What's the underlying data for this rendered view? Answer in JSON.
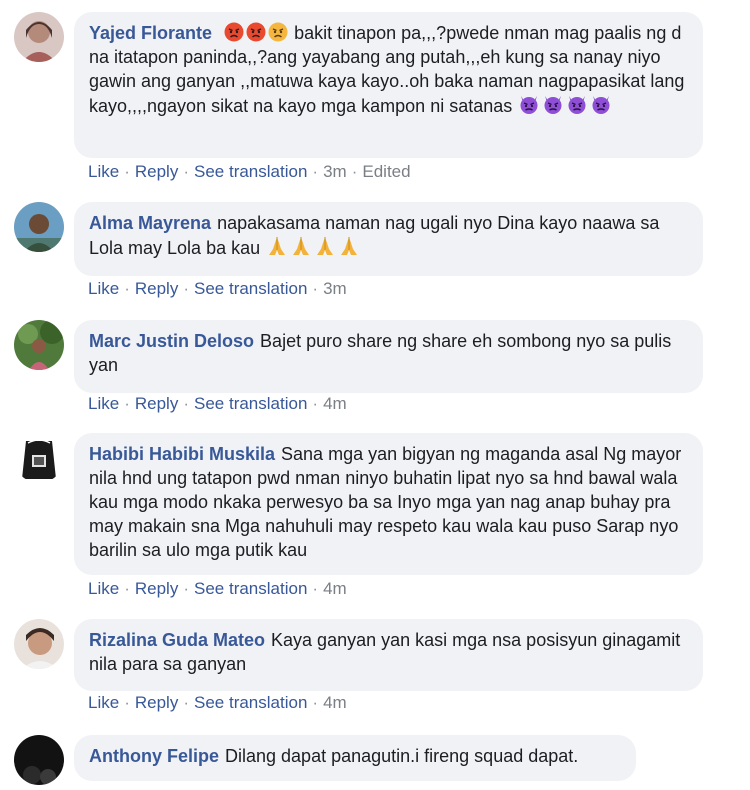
{
  "comments": [
    {
      "author": "Yajed Florante",
      "text": "bakit tinapon pa,,,?pwede nman mag paalis ng d na itatapon paninda,,?ang yayabang ang putah,,,eh kung sa nanay niyo gawin ang ganyan ,,matuwa kaya kayo..oh baka naman nagpapasikat lang kayo,,,,ngayon sikat na kayo mga kampon ni satanas",
      "leading_emoji": [
        "angry-face-icon",
        "angry-face-icon",
        "frowning-face-icon"
      ],
      "trailing_emoji": [
        "devil-face-icon",
        "devil-face-icon",
        "devil-face-icon",
        "devil-face-icon"
      ],
      "like": "Like",
      "reply": "Reply",
      "translate": "See translation",
      "time": "3m",
      "edited": "Edited"
    },
    {
      "author": "Alma Mayrena",
      "text": "napakasama naman nag ugali nyo Dina kayo naawa sa Lola may Lola ba kau",
      "trailing_emoji": [
        "praying-hands-icon",
        "praying-hands-icon",
        "praying-hands-icon",
        "praying-hands-icon"
      ],
      "like": "Like",
      "reply": "Reply",
      "translate": "See translation",
      "time": "3m"
    },
    {
      "author": "Marc Justin Deloso",
      "text": "Bajet puro share ng share eh sombong nyo sa pulis yan",
      "like": "Like",
      "reply": "Reply",
      "translate": "See translation",
      "time": "4m"
    },
    {
      "author": "Habibi Habibi Muskila",
      "text": "Sana mga yan bigyan ng maganda asal Ng mayor nila hnd ung tatapon pwd nman ninyo buhatin lipat nyo sa hnd bawal wala kau mga modo nkaka perwesyo ba sa Inyo mga yan nag anap buhay pra may makain sna Mga nahuhuli may respeto kau wala kau puso Sarap nyo barilin sa ulo mga putik kau",
      "like": "Like",
      "reply": "Reply",
      "translate": "See translation",
      "time": "4m"
    },
    {
      "author": "Rizalina Guda Mateo",
      "text": "Kaya ganyan yan kasi mga nsa posisyun ginagamit nila para sa ganyan",
      "like": "Like",
      "reply": "Reply",
      "translate": "See translation",
      "time": "4m"
    },
    {
      "author": "Anthony Felipe",
      "text": "Dilang dapat panagutin.i fireng squad dapat."
    }
  ],
  "colors": {
    "author_link": "#385898",
    "bubble_bg": "#f0f2f5",
    "meta_text": "#7a7f86"
  }
}
